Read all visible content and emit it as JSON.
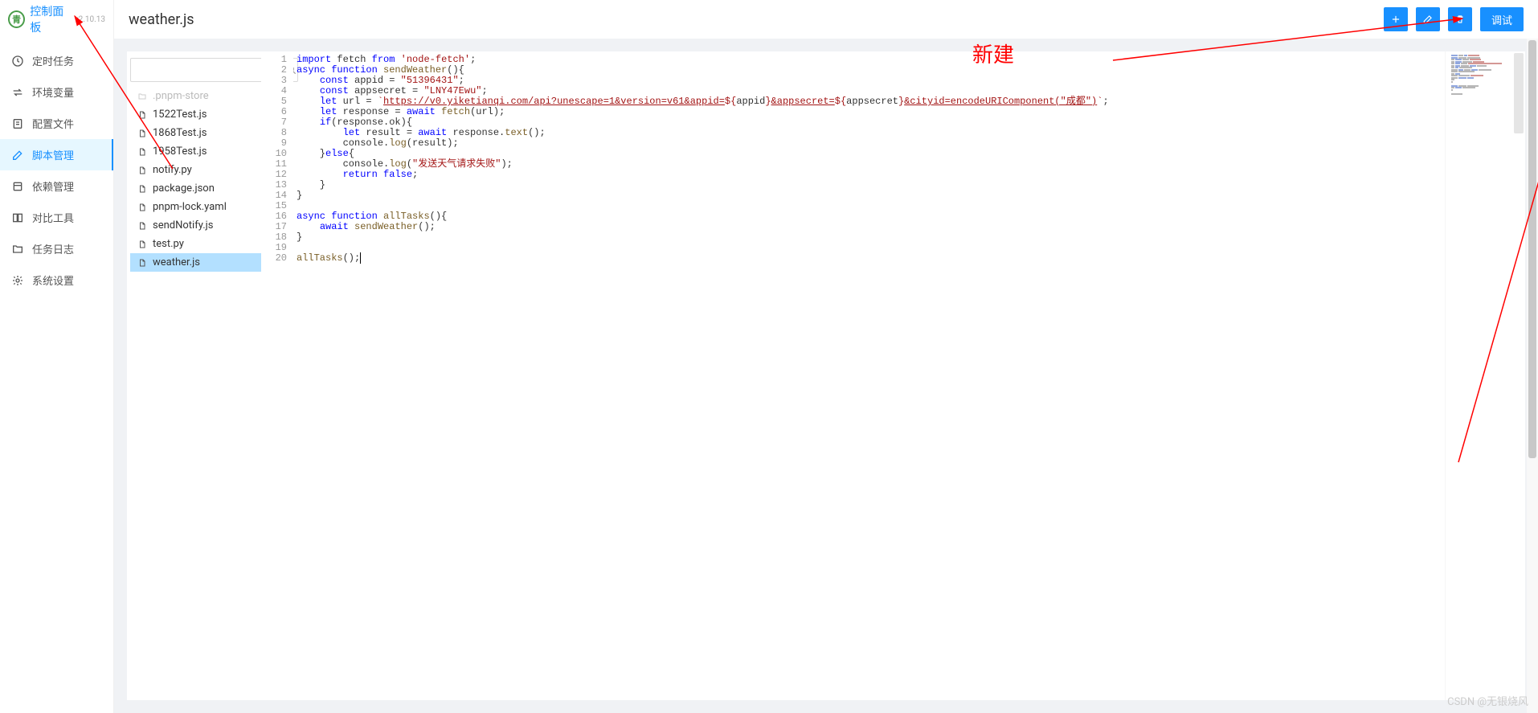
{
  "brand": {
    "name": "控制面板",
    "version": "v2.10.13"
  },
  "sidebar": {
    "items": [
      {
        "label": "定时任务",
        "icon": "clock"
      },
      {
        "label": "环境变量",
        "icon": "swap"
      },
      {
        "label": "配置文件",
        "icon": "file-setting"
      },
      {
        "label": "脚本管理",
        "icon": "edit",
        "active": true
      },
      {
        "label": "依赖管理",
        "icon": "package"
      },
      {
        "label": "对比工具",
        "icon": "diff"
      },
      {
        "label": "任务日志",
        "icon": "folder"
      },
      {
        "label": "系统设置",
        "icon": "gear"
      }
    ]
  },
  "header": {
    "title": "weather.js",
    "debugLabel": "调试"
  },
  "search": {
    "placeholder": ""
  },
  "files": [
    {
      "name": ".pnpm-store",
      "type": "folder",
      "disabled": true
    },
    {
      "name": "1522Test.js",
      "type": "file"
    },
    {
      "name": "1868Test.js",
      "type": "file"
    },
    {
      "name": "1958Test.js",
      "type": "file"
    },
    {
      "name": "notify.py",
      "type": "file"
    },
    {
      "name": "package.json",
      "type": "file"
    },
    {
      "name": "pnpm-lock.yaml",
      "type": "file"
    },
    {
      "name": "sendNotify.js",
      "type": "file"
    },
    {
      "name": "test.py",
      "type": "file"
    },
    {
      "name": "weather.js",
      "type": "file",
      "selected": true
    }
  ],
  "code": {
    "appid": "51396431",
    "appsecret": "LNY47Ewu",
    "url_base": "https://v0.yiketianqi.com/api?unescape=1&version=v61&appid=",
    "url_mid": "&appsecret=",
    "url_end": "&cityid=encodeURIComponent(\"成都\")",
    "err_msg": "发送天气请求失败"
  },
  "lineCount": 20,
  "annotation": {
    "text": "新建"
  },
  "watermark": "CSDN @无银烧风"
}
